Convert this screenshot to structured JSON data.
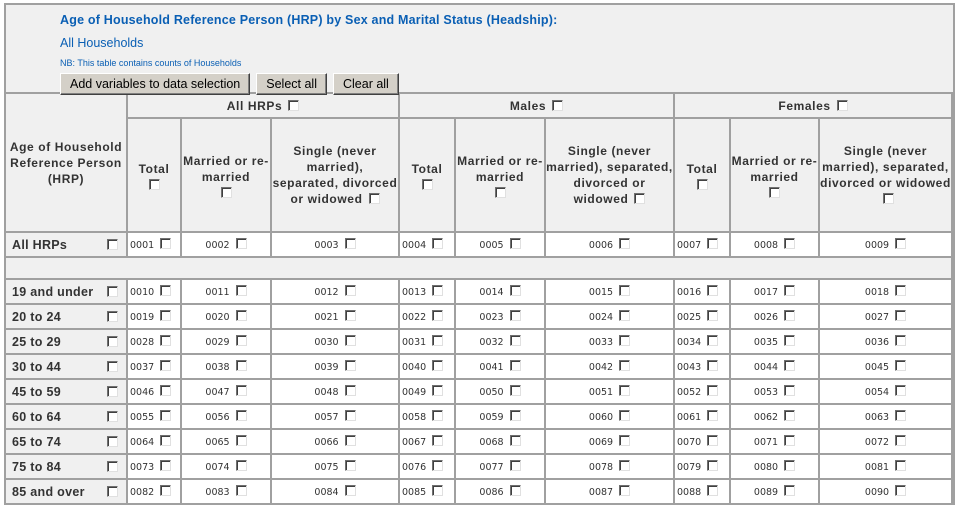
{
  "header": {
    "title": "Age of Household Reference Person (HRP) by Sex and Marital Status (Headship):",
    "subtitle": "All Households",
    "note": "NB: This table contains counts of Households",
    "buttons": {
      "add": "Add variables to data selection",
      "select_all": "Select all",
      "clear_all": "Clear all"
    }
  },
  "table": {
    "row_header_label": "Age of Household Reference Person (HRP)",
    "groups": [
      "All HRPs",
      "Males",
      "Females"
    ],
    "subcolumns": [
      "Total",
      "Married or re-married",
      "Single (never married), separated, divorced or widowed"
    ],
    "total_row": {
      "label": "All HRPs",
      "cells": [
        "0001",
        "0002",
        "0003",
        "0004",
        "0005",
        "0006",
        "0007",
        "0008",
        "0009"
      ]
    },
    "rows": [
      {
        "label": "19 and under",
        "cells": [
          "0010",
          "0011",
          "0012",
          "0013",
          "0014",
          "0015",
          "0016",
          "0017",
          "0018"
        ]
      },
      {
        "label": "20 to 24",
        "cells": [
          "0019",
          "0020",
          "0021",
          "0022",
          "0023",
          "0024",
          "0025",
          "0026",
          "0027"
        ]
      },
      {
        "label": "25 to 29",
        "cells": [
          "0028",
          "0029",
          "0030",
          "0031",
          "0032",
          "0033",
          "0034",
          "0035",
          "0036"
        ]
      },
      {
        "label": "30 to 44",
        "cells": [
          "0037",
          "0038",
          "0039",
          "0040",
          "0041",
          "0042",
          "0043",
          "0044",
          "0045"
        ]
      },
      {
        "label": "45 to 59",
        "cells": [
          "0046",
          "0047",
          "0048",
          "0049",
          "0050",
          "0051",
          "0052",
          "0053",
          "0054"
        ]
      },
      {
        "label": "60 to 64",
        "cells": [
          "0055",
          "0056",
          "0057",
          "0058",
          "0059",
          "0060",
          "0061",
          "0062",
          "0063"
        ]
      },
      {
        "label": "65 to 74",
        "cells": [
          "0064",
          "0065",
          "0066",
          "0067",
          "0068",
          "0069",
          "0070",
          "0071",
          "0072"
        ]
      },
      {
        "label": "75 to 84",
        "cells": [
          "0073",
          "0074",
          "0075",
          "0076",
          "0077",
          "0078",
          "0079",
          "0080",
          "0081"
        ]
      },
      {
        "label": "85 and over",
        "cells": [
          "0082",
          "0083",
          "0084",
          "0085",
          "0086",
          "0087",
          "0088",
          "0089",
          "0090"
        ]
      }
    ]
  }
}
